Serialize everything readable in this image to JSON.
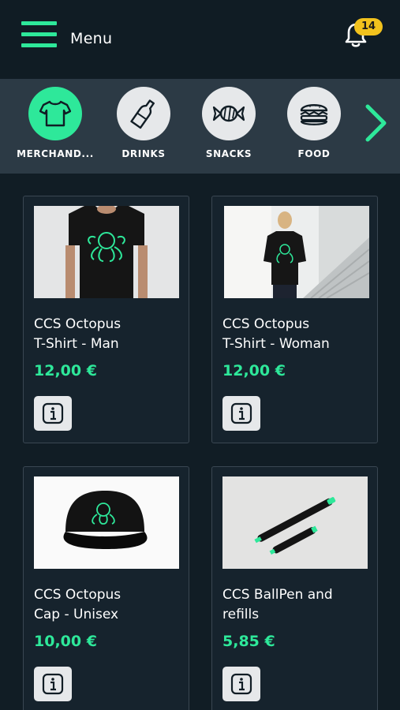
{
  "header": {
    "menu_label": "Menu",
    "notification_count": "14"
  },
  "categories": [
    {
      "label": "MERCHAND...",
      "icon": "tshirt-icon",
      "active": true
    },
    {
      "label": "DRINKS",
      "icon": "bottle-icon",
      "active": false
    },
    {
      "label": "SNACKS",
      "icon": "candy-icon",
      "active": false
    },
    {
      "label": "FOOD",
      "icon": "burger-icon",
      "active": false
    }
  ],
  "products": [
    {
      "name": "CCS Octopus\nT-Shirt - Man",
      "price": "12,00 €",
      "image": "black-tshirt-man-photo"
    },
    {
      "name": "CCS Octopus\nT-Shirt - Woman",
      "price": "12,00 €",
      "image": "black-tshirt-woman-photo"
    },
    {
      "name": "CCS Octopus\n Cap - Unisex",
      "price": "10,00 €",
      "image": "black-cap-photo"
    },
    {
      "name": "CCS BallPen and\nrefills",
      "price": "5,85 €",
      "image": "ballpen-photo"
    }
  ],
  "colors": {
    "accent": "#2ee89a",
    "background": "#111d25",
    "category_bar": "#2c3a45",
    "badge": "#f2c21d"
  }
}
